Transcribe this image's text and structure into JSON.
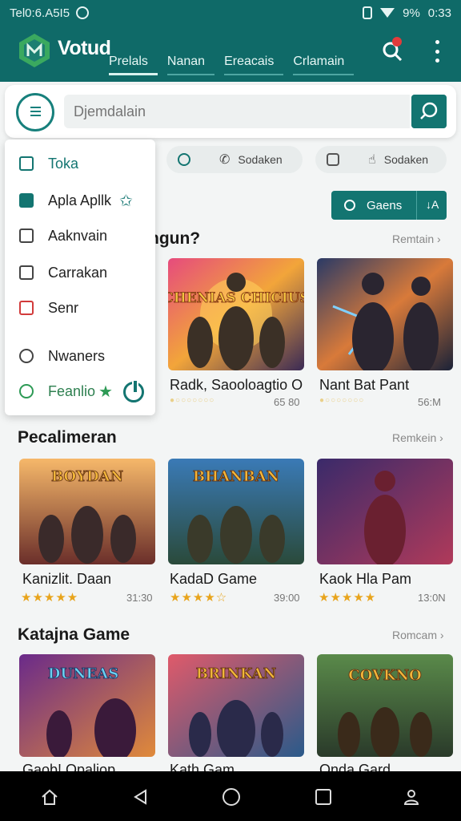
{
  "status_bar": {
    "time_left": "Tel0:6.A5I5",
    "battery": "9%",
    "time_right": "0:33"
  },
  "app": {
    "title": "Votud"
  },
  "tabs": [
    {
      "label": "Prelals"
    },
    {
      "label": "Nanan"
    },
    {
      "label": "Ereacais"
    },
    {
      "label": "Crlamain"
    }
  ],
  "search": {
    "placeholder": "Djemdalain"
  },
  "chips": [
    {
      "label": "Sodaken"
    },
    {
      "label": "Sodaken"
    }
  ],
  "games_button": {
    "label": "Gaens",
    "sort": "↓A"
  },
  "drawer": {
    "items": [
      {
        "label": "Toka"
      },
      {
        "label": "Apla Apllk"
      },
      {
        "label": "Aaknvain"
      },
      {
        "label": "Carrakan"
      },
      {
        "label": "Senr"
      },
      {
        "label": "Nwaners"
      },
      {
        "label": "Feanlio"
      }
    ]
  },
  "sections": [
    {
      "title": "ngun?",
      "more": "Remtain ›",
      "cards": [
        {
          "title": "Radk, Saooloagtio O",
          "stars": "●○○○○○○○",
          "meta": "65 80",
          "art": "CHENIAS CHICIUS"
        },
        {
          "title": "Nant Bat Pant",
          "stars": "●○○○○○○○",
          "meta": "56:M",
          "art": ""
        }
      ]
    },
    {
      "title": "Pecalimeran",
      "more": "Remkein ›",
      "cards": [
        {
          "title": "Kanizlit. Daan",
          "stars": "★★★★★",
          "meta": "31:30",
          "art": "BOYDAN"
        },
        {
          "title": "KadaD Game",
          "stars": "★★★★☆",
          "meta": "39:00",
          "art": "BHANBAN"
        },
        {
          "title": "Kaok Hla Pam",
          "stars": "★★★★★",
          "meta": "13:0N",
          "art": ""
        }
      ]
    },
    {
      "title": "Katajna Game",
      "more": "Romcam ›",
      "cards": [
        {
          "title": "Gaob! Opaliop",
          "stars": "",
          "meta": "",
          "art": "DUNEAS"
        },
        {
          "title": "Kath Gam",
          "stars": "",
          "meta": "",
          "art": "BRINKAN"
        },
        {
          "title": "Onda Gard",
          "stars": "",
          "meta": "",
          "art": "COVKNO"
        }
      ]
    }
  ],
  "colors": {
    "primary": "#0f6a68",
    "accent": "#137571",
    "star": "#e8a41c"
  }
}
